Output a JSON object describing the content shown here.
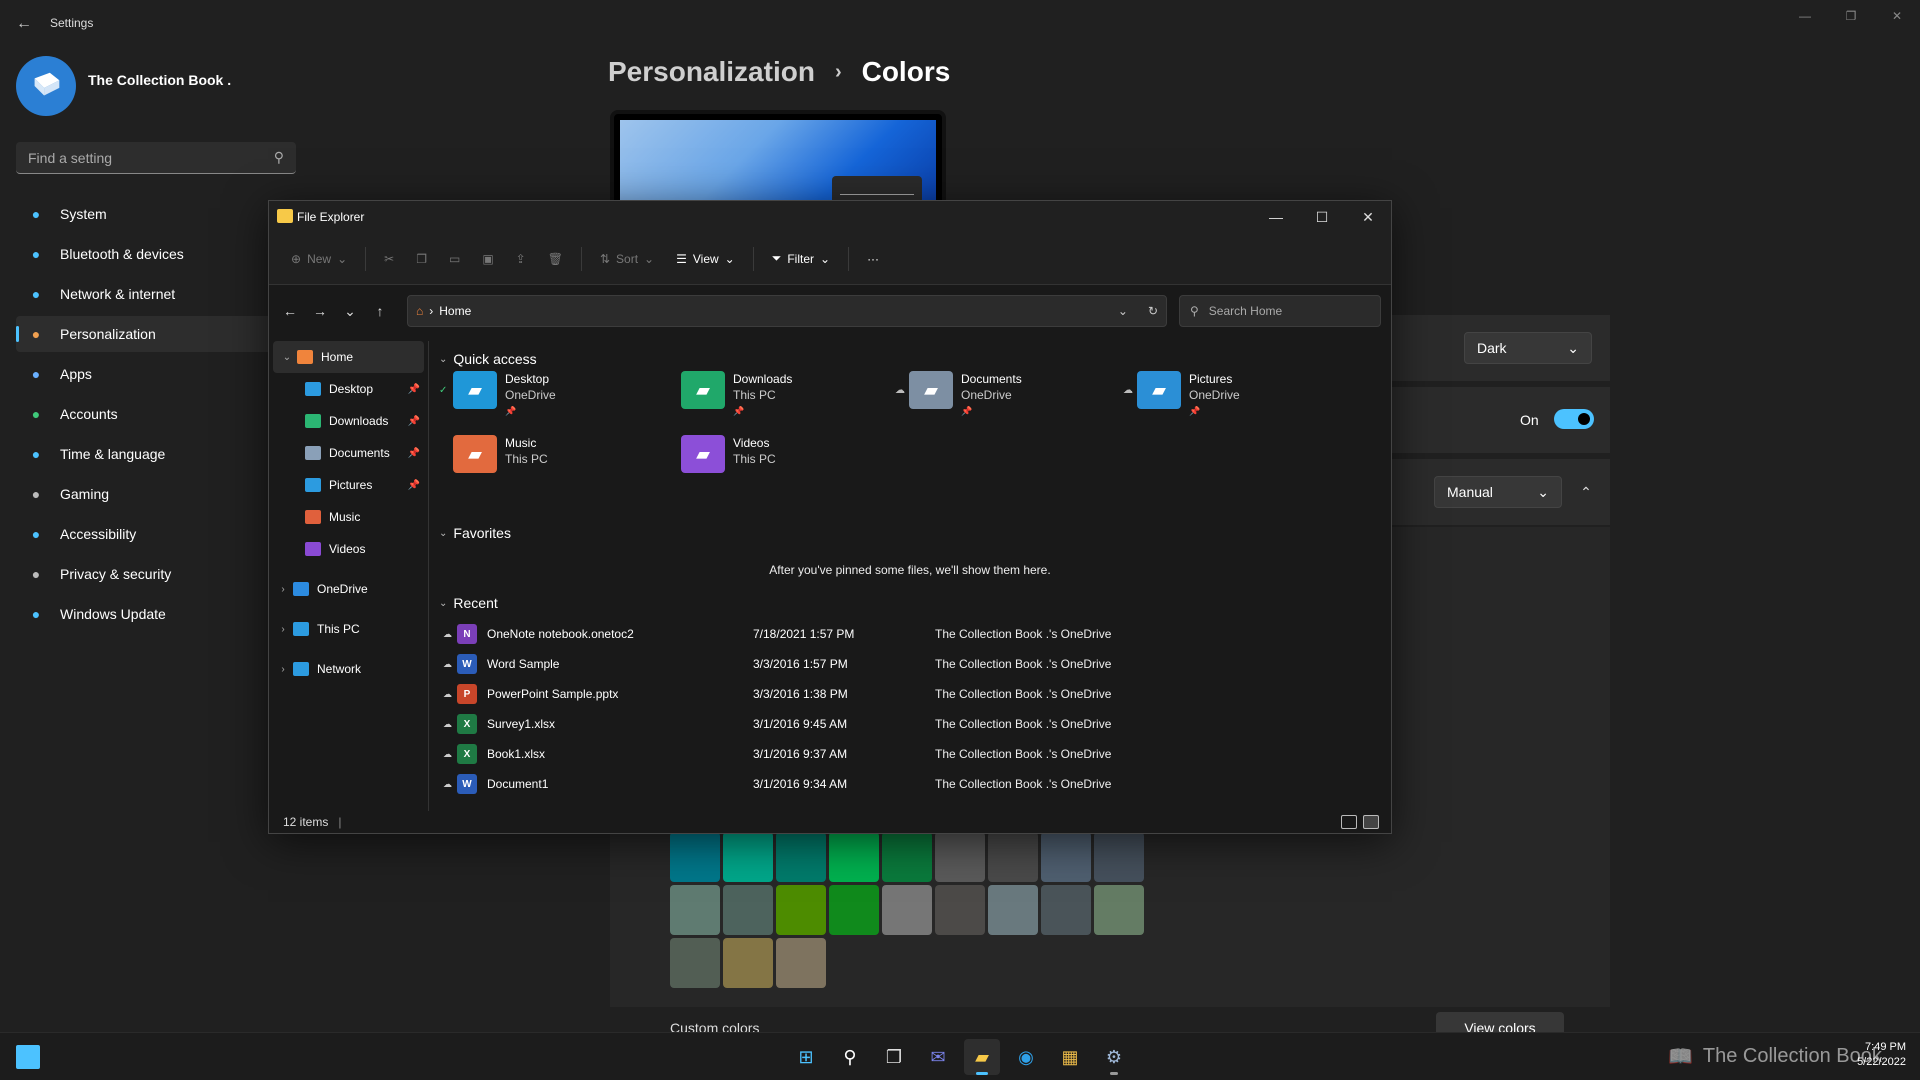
{
  "settings": {
    "title": "Settings",
    "profile_name": "The Collection Book .",
    "search_placeholder": "Find a setting",
    "nav": [
      {
        "label": "System",
        "icon": "system-icon",
        "color": "#4cc2ff"
      },
      {
        "label": "Bluetooth & devices",
        "icon": "bluetooth-icon",
        "color": "#4cc2ff"
      },
      {
        "label": "Network & internet",
        "icon": "network-icon",
        "color": "#4cc2ff"
      },
      {
        "label": "Personalization",
        "icon": "personalization-icon",
        "color": "#f0a050",
        "active": true
      },
      {
        "label": "Apps",
        "icon": "apps-icon",
        "color": "#6ab0ff"
      },
      {
        "label": "Accounts",
        "icon": "accounts-icon",
        "color": "#3fc97a"
      },
      {
        "label": "Time & language",
        "icon": "time-language-icon",
        "color": "#4cc2ff"
      },
      {
        "label": "Gaming",
        "icon": "gaming-icon",
        "color": "#bbbbbb"
      },
      {
        "label": "Accessibility",
        "icon": "accessibility-icon",
        "color": "#4cc2ff"
      },
      {
        "label": "Privacy & security",
        "icon": "shield-icon",
        "color": "#bbbbbb"
      },
      {
        "label": "Windows Update",
        "icon": "windows-update-icon",
        "color": "#4cc2ff"
      }
    ],
    "breadcrumb_parent": "Personalization",
    "breadcrumb_sep": "›",
    "breadcrumb_current": "Colors",
    "mode_value": "Dark",
    "transparency_label": "On",
    "accent_value": "Manual",
    "custom_colors_label": "Custom colors",
    "view_colors_label": "View colors",
    "swatches": [
      [
        "#00778a",
        "#00a78a",
        "#007b6b",
        "#00b14f",
        "#0a7a3c",
        "#5a5a5a",
        "#4a4a4a",
        "#4f5f70",
        "#45505c"
      ],
      [
        "#5f7b71",
        "#4d635d",
        "#4d8c00",
        "#108a1c",
        "#767676",
        "#4c4a48",
        "#69797e",
        "#4a5459",
        "#647c64"
      ],
      [
        "#525e54",
        "#847545",
        "#7e735f"
      ]
    ]
  },
  "explorer": {
    "title": "File Explorer",
    "toolbar": {
      "new": "New",
      "sort": "Sort",
      "view": "View",
      "filter": "Filter",
      "more": "···"
    },
    "address": "Home",
    "search_placeholder": "Search Home",
    "sidebar": [
      {
        "label": "Home",
        "icon": "home-icon",
        "color": "#f0843c",
        "level": 0,
        "expander": "⌄",
        "active": true
      },
      {
        "label": "Desktop",
        "icon": "desktop-icon",
        "color": "#2c9be0",
        "level": 1,
        "pinned": true
      },
      {
        "label": "Downloads",
        "icon": "downloads-icon",
        "color": "#2bb673",
        "level": 1,
        "pinned": true
      },
      {
        "label": "Documents",
        "icon": "documents-icon",
        "color": "#8aa0b8",
        "level": 1,
        "pinned": true
      },
      {
        "label": "Pictures",
        "icon": "pictures-icon",
        "color": "#2c9be0",
        "level": 1,
        "pinned": true
      },
      {
        "label": "Music",
        "icon": "music-icon",
        "color": "#e0603c",
        "level": 1
      },
      {
        "label": "Videos",
        "icon": "videos-icon",
        "color": "#8a4ad4",
        "level": 1
      },
      {
        "label": "OneDrive",
        "icon": "onedrive-icon",
        "color": "#2c8be0",
        "level": 0,
        "expander": "›"
      },
      {
        "label": "This PC",
        "icon": "this-pc-icon",
        "color": "#2c9be0",
        "level": 0,
        "expander": "›"
      },
      {
        "label": "Network",
        "icon": "network-icon",
        "color": "#2c9be0",
        "level": 0,
        "expander": "›"
      }
    ],
    "quick_access_label": "Quick access",
    "quick_access": [
      {
        "name": "Desktop",
        "sub": "OneDrive",
        "icon": "desktop-folder-icon",
        "color": "#1f97d8",
        "status": "✓",
        "pinned": true
      },
      {
        "name": "Downloads",
        "sub": "This PC",
        "icon": "downloads-folder-icon",
        "color": "#20a86a",
        "status": "",
        "pinned": true
      },
      {
        "name": "Documents",
        "sub": "OneDrive",
        "icon": "documents-folder-icon",
        "color": "#7d8fa3",
        "status": "☁",
        "pinned": true
      },
      {
        "name": "Pictures",
        "sub": "OneDrive",
        "icon": "pictures-folder-icon",
        "color": "#2b8fd6",
        "status": "☁",
        "pinned": true
      },
      {
        "name": "Music",
        "sub": "This PC",
        "icon": "music-folder-icon",
        "color": "#e26a3e",
        "status": "",
        "pinned": false
      },
      {
        "name": "Videos",
        "sub": "This PC",
        "icon": "videos-folder-icon",
        "color": "#8c4fd8",
        "status": "",
        "pinned": false
      }
    ],
    "favorites_label": "Favorites",
    "favorites_empty": "After you've pinned some files, we'll show them here.",
    "recent_label": "Recent",
    "recent": [
      {
        "name": "OneNote notebook.onetoc2",
        "date": "7/18/2021 1:57 PM",
        "location": "The Collection Book .'s OneDrive",
        "icon": "onenote-file-icon",
        "color": "#7b3fb8",
        "glyph": "N"
      },
      {
        "name": "Word Sample",
        "date": "3/3/2016 1:57 PM",
        "location": "The Collection Book .'s OneDrive",
        "icon": "word-file-icon",
        "color": "#2b5cb8",
        "glyph": "W"
      },
      {
        "name": "PowerPoint Sample.pptx",
        "date": "3/3/2016 1:38 PM",
        "location": "The Collection Book .'s OneDrive",
        "icon": "powerpoint-file-icon",
        "color": "#c8462a",
        "glyph": "P"
      },
      {
        "name": "Survey1.xlsx",
        "date": "3/1/2016 9:45 AM",
        "location": "The Collection Book .'s OneDrive",
        "icon": "excel-file-icon",
        "color": "#1f7a44",
        "glyph": "X"
      },
      {
        "name": "Book1.xlsx",
        "date": "3/1/2016 9:37 AM",
        "location": "The Collection Book .'s OneDrive",
        "icon": "excel-file-icon",
        "color": "#1f7a44",
        "glyph": "X"
      },
      {
        "name": "Document1",
        "date": "3/1/2016 9:34 AM",
        "location": "The Collection Book .'s OneDrive",
        "icon": "word-file-icon",
        "color": "#2b5cb8",
        "glyph": "W"
      }
    ],
    "status": "12 items"
  },
  "taskbar": {
    "apps": [
      {
        "name": "start-button",
        "glyph": "⊞",
        "color": "#4cc2ff"
      },
      {
        "name": "search-button",
        "glyph": "⚲",
        "color": "#ffffff"
      },
      {
        "name": "task-view-button",
        "glyph": "❐",
        "color": "#dddddd"
      },
      {
        "name": "chat-button",
        "glyph": "✉",
        "color": "#7b83eb"
      },
      {
        "name": "file-explorer-button",
        "glyph": "▰",
        "color": "#f7c948",
        "state": "active"
      },
      {
        "name": "edge-button",
        "glyph": "◉",
        "color": "#2fa0e8"
      },
      {
        "name": "store-button",
        "glyph": "▦",
        "color": "#e8b848"
      },
      {
        "name": "settings-button",
        "glyph": "⚙",
        "color": "#9fb8d8",
        "state": "running"
      }
    ],
    "watermark": "The Collection Book",
    "time": "7:49 PM",
    "date": "5/22/2022"
  }
}
